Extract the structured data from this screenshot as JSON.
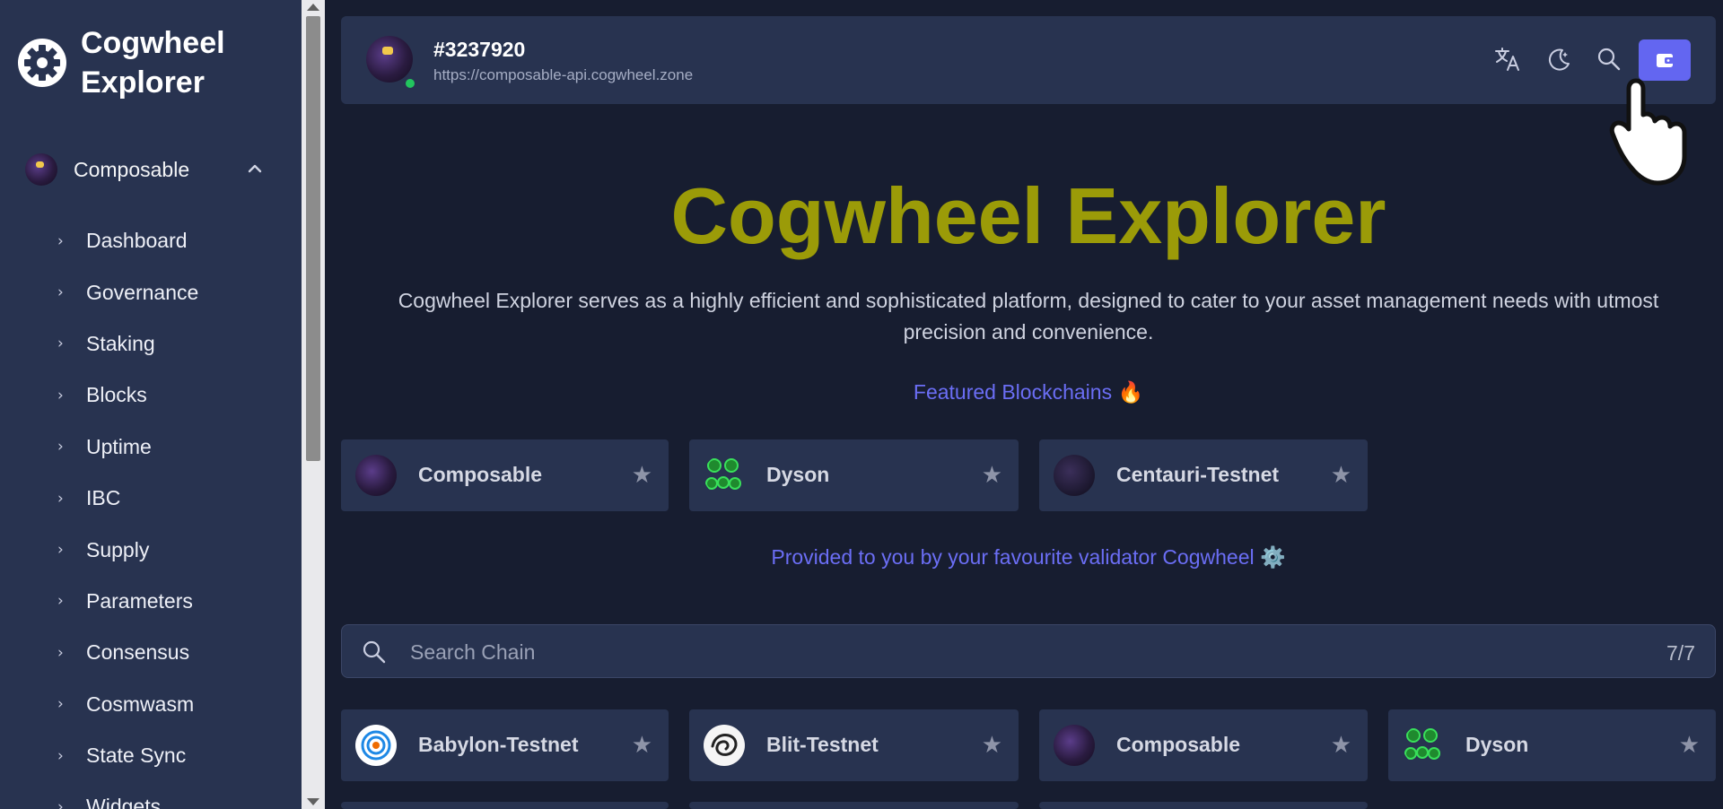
{
  "sidebar": {
    "brand_line1": "Cogwheel",
    "brand_line2": "Explorer",
    "selected_chain": "Composable",
    "items": [
      {
        "label": "Dashboard"
      },
      {
        "label": "Governance"
      },
      {
        "label": "Staking"
      },
      {
        "label": "Blocks"
      },
      {
        "label": "Uptime"
      },
      {
        "label": "IBC"
      },
      {
        "label": "Supply"
      },
      {
        "label": "Parameters"
      },
      {
        "label": "Consensus"
      },
      {
        "label": "Cosmwasm"
      },
      {
        "label": "State Sync"
      },
      {
        "label": "Widgets"
      }
    ]
  },
  "header": {
    "block_height": "#3237920",
    "endpoint": "https://composable-api.cogwheel.zone",
    "icons": [
      "translate-icon",
      "theme-toggle-icon",
      "search-icon",
      "wallet-icon"
    ]
  },
  "hero": {
    "title": "Cogwheel Explorer",
    "description_line1": "Cogwheel Explorer serves as a highly efficient and sophisticated platform, designed to cater to your asset management needs with utmost",
    "description_line2": "precision and convenience.",
    "featured_label": "Featured Blockchains 🔥",
    "provided_label": "Provided to you by your favourite validator Cogwheel ⚙️"
  },
  "featured_chains": [
    {
      "name": "Composable",
      "logo": "composable-logo"
    },
    {
      "name": "Dyson",
      "logo": "dyson-logo"
    },
    {
      "name": "Centauri-Testnet",
      "logo": "centauri-logo"
    }
  ],
  "search": {
    "placeholder": "Search Chain",
    "count": "7/7"
  },
  "chains": [
    {
      "name": "Babylon-Testnet",
      "logo": "babylon-logo"
    },
    {
      "name": "Blit-Testnet",
      "logo": "blit-logo"
    },
    {
      "name": "Composable",
      "logo": "composable-logo"
    },
    {
      "name": "Dyson",
      "logo": "dyson-logo"
    }
  ],
  "colors": {
    "background": "#171d30",
    "panel": "#283350",
    "accent": "#6366f1",
    "title": "#9b9b08"
  }
}
